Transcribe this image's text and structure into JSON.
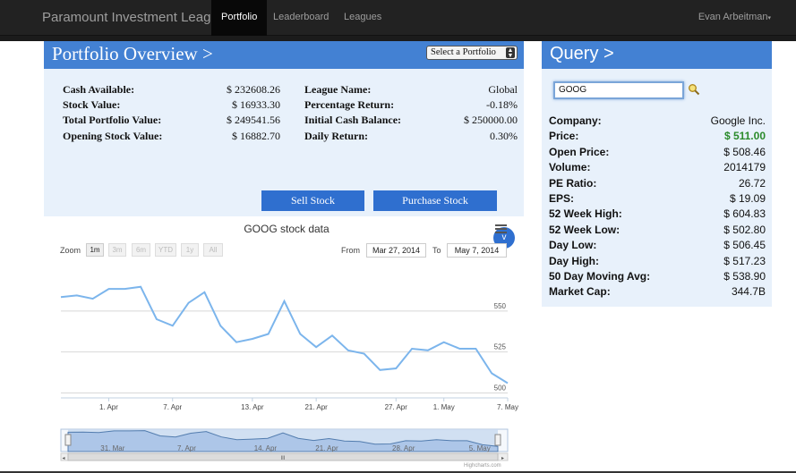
{
  "nav": {
    "brand": "Paramount Investment League",
    "items": [
      {
        "label": "Portfolio",
        "active": true
      },
      {
        "label": "Leaderboard",
        "active": false
      },
      {
        "label": "Leagues",
        "active": false
      }
    ],
    "user": "Evan Arbeitman"
  },
  "portfolio": {
    "title": "Portfolio Overview >",
    "select_label": "Select a Portfolio",
    "left_stats": [
      {
        "label": "Cash Available:",
        "value": "$ 232608.26"
      },
      {
        "label": "Stock Value:",
        "value": "$ 16933.30"
      },
      {
        "label": "Total Portfolio Value:",
        "value": "$ 249541.56"
      },
      {
        "label": "Opening Stock Value:",
        "value": "$ 16882.70"
      }
    ],
    "right_stats": [
      {
        "label": "League Name:",
        "value": "Global"
      },
      {
        "label": "Percentage Return:",
        "value": "-0.18%"
      },
      {
        "label": "Initial Cash Balance:",
        "value": "$ 250000.00"
      },
      {
        "label": "Daily Return:",
        "value": "0.30%"
      }
    ],
    "sell_label": "Sell Stock",
    "purchase_label": "Purchase Stock",
    "expand_glyph": "v"
  },
  "stock_chart": {
    "zoom_label": "Zoom",
    "zoom_buttons": [
      {
        "label": "1m",
        "enabled": true
      },
      {
        "label": "3m",
        "enabled": false
      },
      {
        "label": "6m",
        "enabled": false
      },
      {
        "label": "YTD",
        "enabled": false
      },
      {
        "label": "1y",
        "enabled": false
      },
      {
        "label": "All",
        "enabled": false
      }
    ],
    "from_label": "From",
    "from_date": "Mar 27, 2014",
    "to_label": "To",
    "to_date": "May 7, 2014",
    "credit": "Highcharts.com",
    "scrollbar_grip": "III",
    "colors": {
      "line": "#7cb5ec",
      "navigator_fill": "#c8d9ef",
      "navigator_line": "#4572a7"
    }
  },
  "chart_data": {
    "type": "line",
    "title": "GOOG stock data",
    "x": [
      "Mar 27",
      "Mar 28",
      "Mar 31",
      "Apr 1",
      "Apr 2",
      "Apr 3",
      "Apr 4",
      "Apr 7",
      "Apr 8",
      "Apr 9",
      "Apr 10",
      "Apr 11",
      "Apr 14",
      "Apr 15",
      "Apr 16",
      "Apr 17",
      "Apr 21",
      "Apr 22",
      "Apr 23",
      "Apr 24",
      "Apr 25",
      "Apr 28",
      "Apr 29",
      "Apr 30",
      "May 1",
      "May 2",
      "May 5",
      "May 6",
      "May 7"
    ],
    "series": [
      {
        "values": [
          558.5,
          559.5,
          557.5,
          563.5,
          563.5,
          564.8,
          545,
          541,
          555,
          561.5,
          541,
          531,
          533,
          536,
          556,
          536,
          528,
          535,
          526,
          524,
          514,
          515,
          527,
          526,
          531,
          527,
          527,
          512,
          506
        ]
      }
    ],
    "ylim": [
      497,
      575
    ],
    "yticks": [
      500,
      525,
      550
    ],
    "xtick_labels": [
      "1. Apr",
      "7. Apr",
      "13. Apr",
      "21. Apr",
      "27. Apr",
      "1. May",
      "7. May"
    ],
    "navigator_labels": [
      "31. Mar",
      "7. Apr",
      "14. Apr",
      "21. Apr",
      "28. Apr",
      "5. May"
    ]
  },
  "query": {
    "title": "Query >",
    "input_value": "GOOG",
    "rows": [
      {
        "label": "Company:",
        "value": "Google Inc.",
        "highlight": false
      },
      {
        "label": "Price:",
        "value": "$ 511.00",
        "highlight": true
      },
      {
        "label": "Open Price:",
        "value": "$ 508.46",
        "highlight": false
      },
      {
        "label": "Volume:",
        "value": "2014179",
        "highlight": false
      },
      {
        "label": "PE Ratio:",
        "value": "26.72",
        "highlight": false
      },
      {
        "label": "EPS:",
        "value": "$ 19.09",
        "highlight": false
      },
      {
        "label": "52 Week High:",
        "value": "$ 604.83",
        "highlight": false
      },
      {
        "label": "52 Week Low:",
        "value": "$ 502.80",
        "highlight": false
      },
      {
        "label": "Day Low:",
        "value": "$ 506.45",
        "highlight": false
      },
      {
        "label": "Day High:",
        "value": "$ 517.23",
        "highlight": false
      },
      {
        "label": "50 Day Moving Avg:",
        "value": "$ 538.90",
        "highlight": false
      },
      {
        "label": "Market Cap:",
        "value": "344.7B",
        "highlight": false
      }
    ]
  }
}
